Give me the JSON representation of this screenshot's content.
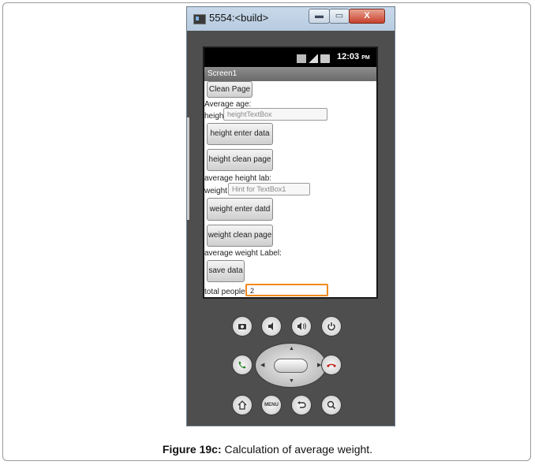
{
  "window": {
    "title": "5554:<build>",
    "controls": {
      "minimize": "▬",
      "maximize": "▭",
      "close": "X"
    }
  },
  "status_bar": {
    "time": "12:03",
    "ampm": "PM"
  },
  "screen": {
    "title": "Screen1",
    "clean_page_button": "Clean Page",
    "average_age_label": "Average age:",
    "height_label": "height",
    "height_textbox_hint": "heightTextBox",
    "height_enter_button": "height enter data",
    "height_clean_button": "height clean page",
    "average_height_label": "average height lab:",
    "weight_label": "weight",
    "weight_textbox_hint": "Hint for TextBox1",
    "weight_enter_button": "weight enter datd",
    "weight_clean_button": "weight clean page",
    "average_weight_label": "average weight Label:",
    "save_button": "save data",
    "total_people_label": "total people",
    "total_people_value": "2"
  },
  "hardware_keys": [
    "camera-icon",
    "volume-down-icon",
    "volume-up-icon",
    "power-icon",
    "call-icon",
    "dpad",
    "end-call-icon",
    "home-icon",
    "menu-icon",
    "back-icon",
    "search-icon"
  ],
  "menu_key_label": "MENU",
  "caption": {
    "prefix": "Figure 19c:",
    "text": "Calculation of average weight."
  },
  "colors": {
    "focus_border": "#f08a1c",
    "call_green": "#2f8a2f",
    "end_call_red": "#c0231a"
  }
}
